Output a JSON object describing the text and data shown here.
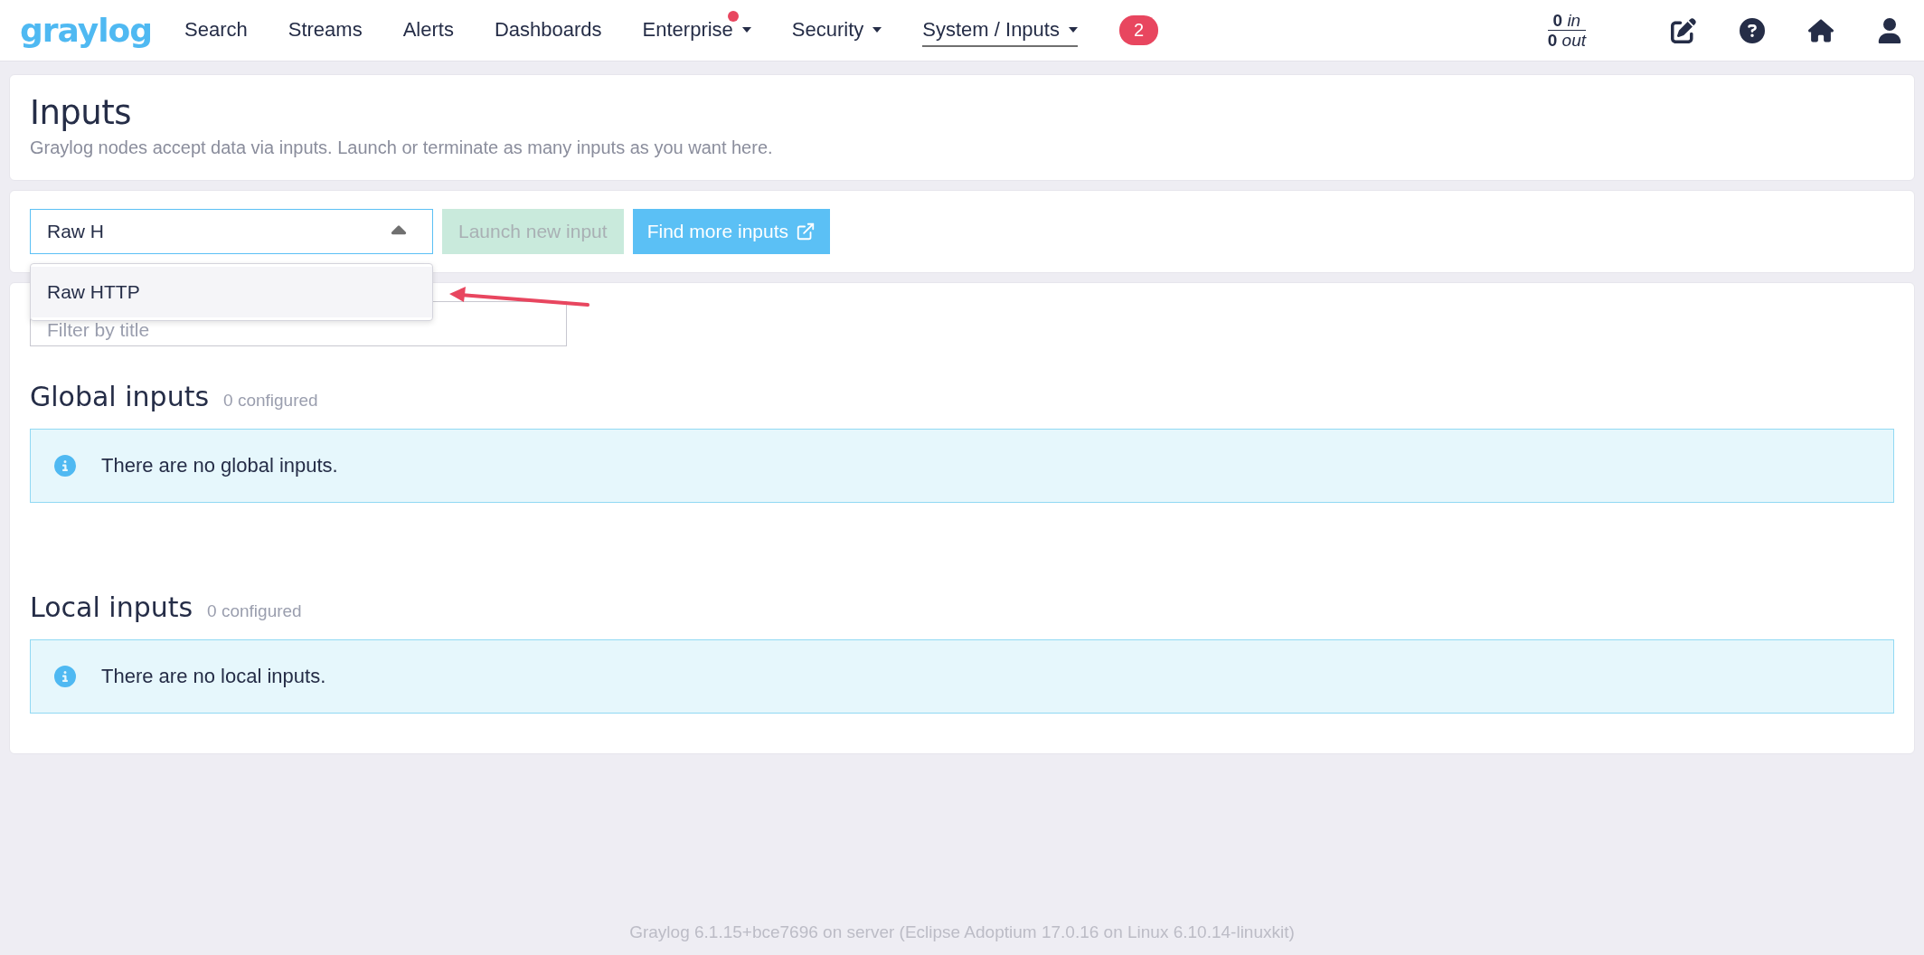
{
  "nav": {
    "logo": "graylog",
    "items": [
      {
        "label": "Search",
        "selected": false,
        "dropdown": false,
        "notification": false
      },
      {
        "label": "Streams",
        "selected": false,
        "dropdown": false,
        "notification": false
      },
      {
        "label": "Alerts",
        "selected": false,
        "dropdown": false,
        "notification": false
      },
      {
        "label": "Dashboards",
        "selected": false,
        "dropdown": false,
        "notification": false
      },
      {
        "label": "Enterprise",
        "selected": false,
        "dropdown": true,
        "notification": true
      },
      {
        "label": "Security",
        "selected": false,
        "dropdown": true,
        "notification": false
      },
      {
        "label": "System / Inputs",
        "selected": true,
        "dropdown": true,
        "notification": false
      }
    ],
    "notification_count": "2",
    "throughput": {
      "in_value": "0",
      "in_label": "in",
      "out_value": "0",
      "out_label": "out"
    }
  },
  "header": {
    "title": "Inputs",
    "description": "Graylog nodes accept data via inputs. Launch or terminate as many inputs as you want here."
  },
  "toolbar": {
    "select": {
      "value": "Raw H",
      "expanded": true
    },
    "options": [
      {
        "label": "Raw HTTP",
        "selected": true
      }
    ],
    "launch_button": {
      "label": "Launch new input",
      "disabled": true
    },
    "find_button": {
      "label": "Find more inputs"
    }
  },
  "filter": {
    "placeholder": "Filter by title"
  },
  "sections": [
    {
      "title": "Global inputs",
      "count": "0 configured",
      "message": "There are no global inputs."
    },
    {
      "title": "Local inputs",
      "count": "0 configured",
      "message": "There are no local inputs."
    }
  ],
  "footer": "Graylog 6.1.15+bce7696 on server (Eclipse Adoptium 17.0.16 on Linux 6.10.14-linuxkit)"
}
